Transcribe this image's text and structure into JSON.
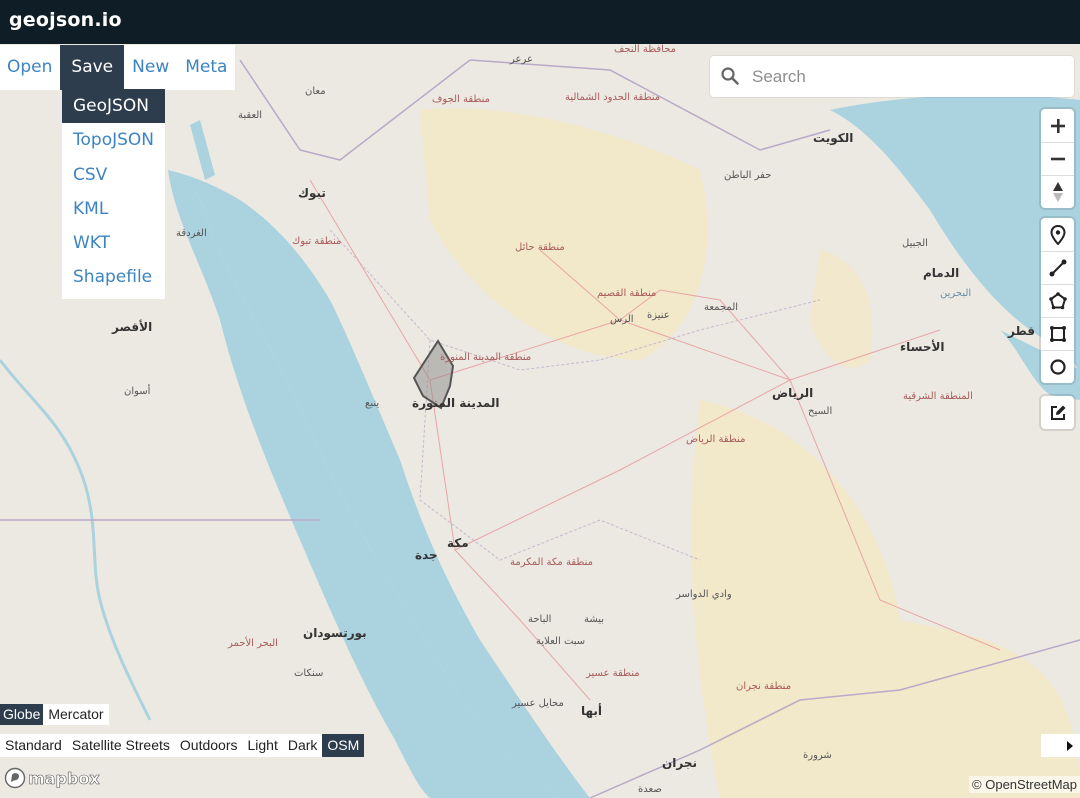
{
  "app": {
    "title": "geojson.io"
  },
  "menu": {
    "items": [
      {
        "label": "Open"
      },
      {
        "label": "Save"
      },
      {
        "label": "New"
      },
      {
        "label": "Meta"
      }
    ],
    "active": "Save"
  },
  "save_dropdown": {
    "items": [
      {
        "label": "GeoJSON"
      },
      {
        "label": "TopoJSON"
      },
      {
        "label": "CSV"
      },
      {
        "label": "KML"
      },
      {
        "label": "WKT"
      },
      {
        "label": "Shapefile"
      }
    ],
    "highlighted": "GeoJSON"
  },
  "search": {
    "placeholder": "Search",
    "value": "",
    "icon": "search-icon"
  },
  "map_controls": {
    "zoom": [
      {
        "icon": "plus-icon"
      },
      {
        "icon": "minus-icon"
      },
      {
        "icon": "compass-icon"
      }
    ],
    "draw": [
      {
        "icon": "marker-icon"
      },
      {
        "icon": "line-icon"
      },
      {
        "icon": "polygon-icon"
      },
      {
        "icon": "rectangle-icon"
      },
      {
        "icon": "circle-icon"
      }
    ],
    "edit": [
      {
        "icon": "edit-icon"
      }
    ]
  },
  "projection": {
    "options": [
      {
        "label": "Globe"
      },
      {
        "label": "Mercator"
      }
    ],
    "active": "Globe"
  },
  "map_styles": {
    "options": [
      {
        "label": "Standard"
      },
      {
        "label": "Satellite Streets"
      },
      {
        "label": "Outdoors"
      },
      {
        "label": "Light"
      },
      {
        "label": "Dark"
      },
      {
        "label": "OSM"
      }
    ],
    "active": "OSM"
  },
  "logo": {
    "text": "mapbox"
  },
  "attribution": {
    "text": "© OpenStreetMap"
  },
  "map_labels": [
    {
      "text": "تبوك"
    },
    {
      "text": "منطقة تبوك"
    },
    {
      "text": "منطقة حائل"
    },
    {
      "text": "منطقة الجوف"
    },
    {
      "text": "منطقة الحدود الشمالية"
    },
    {
      "text": "الكويت"
    },
    {
      "text": "حفر الباطن"
    },
    {
      "text": "منطقة القصيم"
    },
    {
      "text": "عنيزة"
    },
    {
      "text": "الرس"
    },
    {
      "text": "المجمعة"
    },
    {
      "text": "منطقة المدينة المنورة"
    },
    {
      "text": "المدينة المنورة"
    },
    {
      "text": "ينبع"
    },
    {
      "text": "الرياض"
    },
    {
      "text": "منطقة الرياض"
    },
    {
      "text": "السيح"
    },
    {
      "text": "الدمام"
    },
    {
      "text": "البحرين"
    },
    {
      "text": "قطر"
    },
    {
      "text": "الأحساء"
    },
    {
      "text": "المنطقة الشرقية"
    },
    {
      "text": "الجبيل"
    },
    {
      "text": "مكة"
    },
    {
      "text": "جدة"
    },
    {
      "text": "منطقة مكة المكرمة"
    },
    {
      "text": "وادي الدواسر"
    },
    {
      "text": "الباحة"
    },
    {
      "text": "بيشة"
    },
    {
      "text": "سبت العلاية"
    },
    {
      "text": "منطقة عسير"
    },
    {
      "text": "محايل عسير"
    },
    {
      "text": "أبها"
    },
    {
      "text": "منطقة نجران"
    },
    {
      "text": "نجران"
    },
    {
      "text": "شرورة"
    },
    {
      "text": "صعدة"
    },
    {
      "text": "بورتسودان"
    },
    {
      "text": "سنكات"
    },
    {
      "text": "البحر الأحمر"
    },
    {
      "text": "الأقصر"
    },
    {
      "text": "أسوان"
    },
    {
      "text": "العقبة"
    },
    {
      "text": "معان"
    },
    {
      "text": "الغردقة"
    },
    {
      "text": "عرعر"
    },
    {
      "text": "محافظة النجف"
    }
  ],
  "colors": {
    "topbar": "#0f1e26",
    "menu_active": "#2d3d4e",
    "link": "#3c84c2",
    "water": "#aad3df",
    "land": "#ece9e2",
    "desert": "#f4e7c4"
  }
}
